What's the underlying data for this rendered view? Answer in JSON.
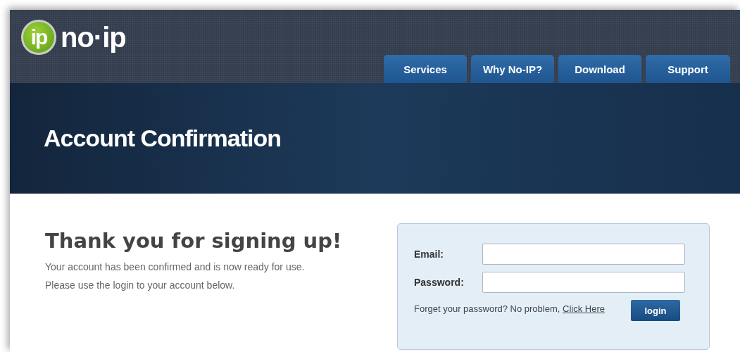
{
  "logo": {
    "badge": "ip",
    "text": "no·ip"
  },
  "nav": [
    {
      "label": "Services"
    },
    {
      "label": "Why No-IP?"
    },
    {
      "label": "Download"
    },
    {
      "label": "Support"
    }
  ],
  "banner": {
    "title": "Account Confirmation"
  },
  "message": {
    "heading": "Thank you for signing up!",
    "lines": [
      "Your account has been confirmed and is now ready for use.",
      "Please use the login to your account below."
    ]
  },
  "login": {
    "fields": [
      {
        "label": "Email:"
      },
      {
        "label": "Password:"
      }
    ],
    "forgot_text": "Forget your password? No problem,",
    "forgot_link": "Click Here",
    "button": "login"
  }
}
